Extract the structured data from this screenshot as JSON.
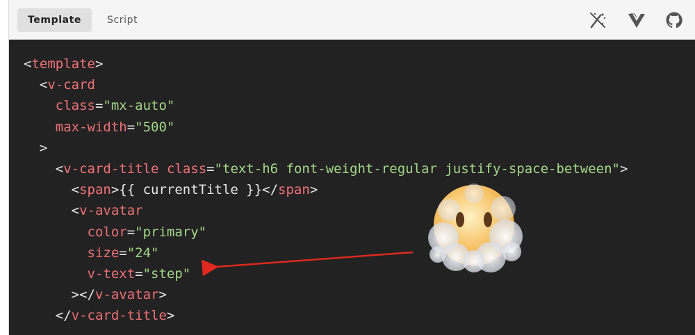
{
  "tabs": [
    {
      "label": "Template",
      "active": true
    },
    {
      "label": "Script",
      "active": false
    }
  ],
  "toolbar_icons": [
    "magic-wand-icon",
    "vuetify-icon",
    "github-icon"
  ],
  "code_lines": [
    [
      {
        "t": "punct",
        "v": "<"
      },
      {
        "t": "tag",
        "v": "template"
      },
      {
        "t": "punct",
        "v": ">"
      }
    ],
    [
      {
        "t": "punct",
        "v": "  <"
      },
      {
        "t": "tag",
        "v": "v-card"
      }
    ],
    [
      {
        "t": "attr",
        "v": "    class"
      },
      {
        "t": "punct",
        "v": "="
      },
      {
        "t": "str",
        "v": "\"mx-auto\""
      }
    ],
    [
      {
        "t": "attr",
        "v": "    max-width"
      },
      {
        "t": "punct",
        "v": "="
      },
      {
        "t": "str",
        "v": "\"500\""
      }
    ],
    [
      {
        "t": "punct",
        "v": "  >"
      }
    ],
    [
      {
        "t": "punct",
        "v": "    <"
      },
      {
        "t": "tag",
        "v": "v-card-title"
      },
      {
        "t": "punct",
        "v": " "
      },
      {
        "t": "attr",
        "v": "class"
      },
      {
        "t": "punct",
        "v": "="
      },
      {
        "t": "str",
        "v": "\"text-h6 font-weight-regular justify-space-between\""
      },
      {
        "t": "punct",
        "v": ">"
      }
    ],
    [
      {
        "t": "punct",
        "v": "      <"
      },
      {
        "t": "tag",
        "v": "span"
      },
      {
        "t": "punct",
        "v": ">{{ currentTitle }}</"
      },
      {
        "t": "tag",
        "v": "span"
      },
      {
        "t": "punct",
        "v": ">"
      }
    ],
    [
      {
        "t": "punct",
        "v": "      <"
      },
      {
        "t": "tag",
        "v": "v-avatar"
      }
    ],
    [
      {
        "t": "attr",
        "v": "        color"
      },
      {
        "t": "punct",
        "v": "="
      },
      {
        "t": "str",
        "v": "\"primary\""
      }
    ],
    [
      {
        "t": "attr",
        "v": "        size"
      },
      {
        "t": "punct",
        "v": "="
      },
      {
        "t": "str",
        "v": "\"24\""
      }
    ],
    [
      {
        "t": "attr",
        "v": "        v-text"
      },
      {
        "t": "punct",
        "v": "="
      },
      {
        "t": "str",
        "v": "\"step\""
      }
    ],
    [
      {
        "t": "punct",
        "v": "      ></"
      },
      {
        "t": "tag",
        "v": "v-avatar"
      },
      {
        "t": "punct",
        "v": ">"
      }
    ],
    [
      {
        "t": "punct",
        "v": "    </"
      },
      {
        "t": "tag",
        "v": "v-card-title"
      },
      {
        "t": "punct",
        "v": ">"
      }
    ]
  ],
  "annotation": {
    "arrow_color": "#e0291f",
    "emoji": "face-in-clouds-emoji"
  },
  "colors": {
    "code_bg": "#222222",
    "tag": "#f07178",
    "string": "#a5d68a",
    "toolbar_bg": "#f5f5f5"
  }
}
